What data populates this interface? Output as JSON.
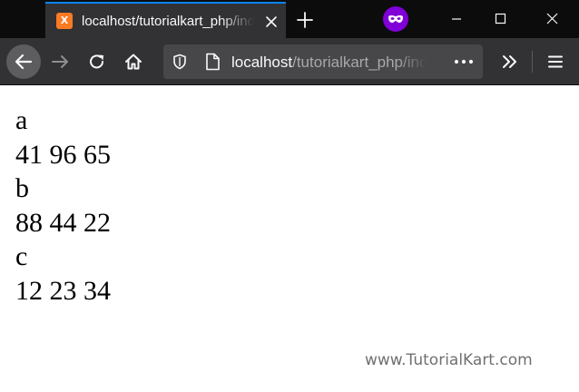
{
  "browser": {
    "tab": {
      "title": "localhost/tutorialkart_php/index.php",
      "favicon_letter": "X"
    },
    "address_bar": {
      "host": "localhost",
      "path": "/tutorialkart_php/index.php"
    },
    "icons": {
      "back": "back-arrow-icon",
      "forward": "forward-arrow-icon",
      "reload": "reload-icon",
      "home": "home-icon",
      "tracking": "shield-icon",
      "page": "page-icon",
      "page_actions": "ellipsis-icon",
      "overflow": "double-chevron-icon",
      "menu": "hamburger-menu-icon",
      "private": "private-browsing-mask-icon"
    },
    "colors": {
      "titlebar": "#0c0c0d",
      "toolbar": "#323234",
      "urlbar": "#474749",
      "tab_accent": "#0a84ff",
      "private_badge": "#8000d7",
      "favicon": "#fb7a24"
    }
  },
  "page": {
    "lines": [
      "a",
      "41 96 65",
      "b",
      "88 44 22",
      "c",
      "12 23 34"
    ],
    "watermark": "www.TutorialKart.com"
  }
}
